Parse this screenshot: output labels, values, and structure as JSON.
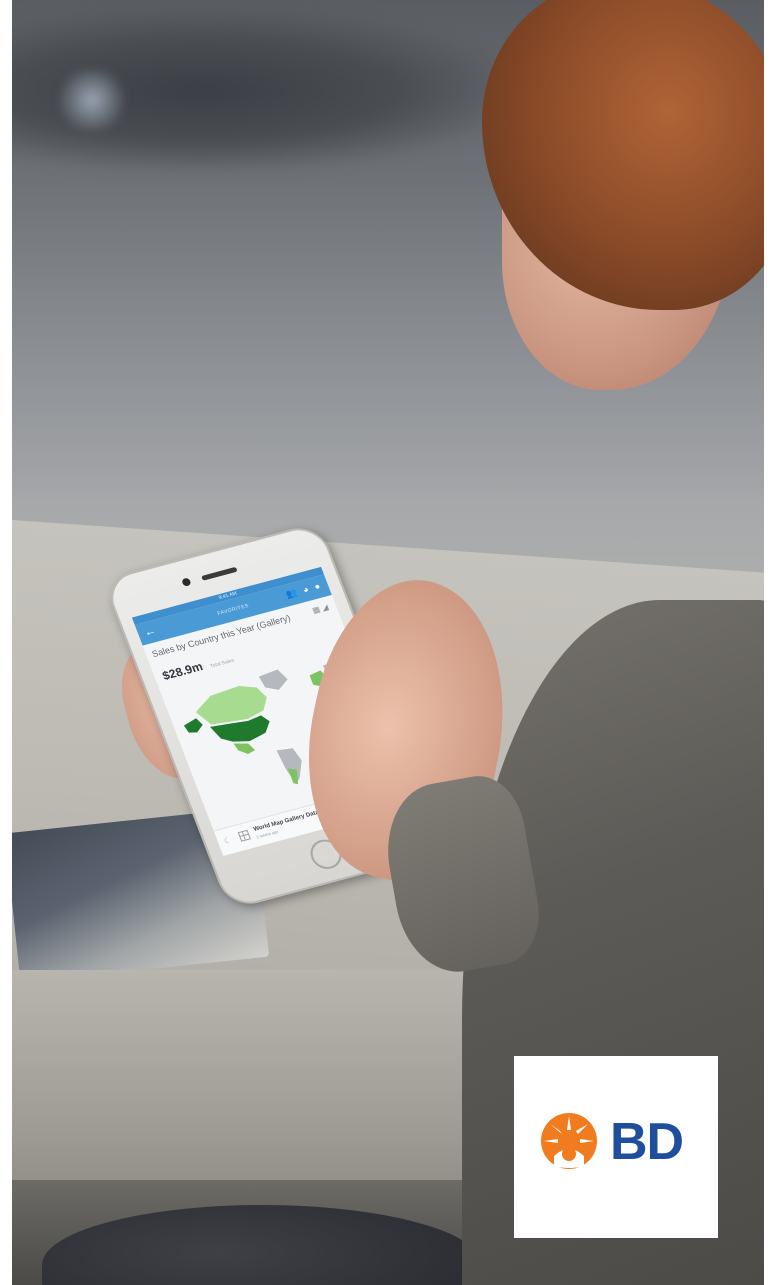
{
  "phone_screen": {
    "status_time": "9:41 AM",
    "app_bar_title": "FAVORITES",
    "card_title": "Sales by Country this Year (Gallery)",
    "metric_value": "$28.9m",
    "metric_label": "Total Sales",
    "footer_title": "World Map Gallery Data",
    "footer_subtitle": "2 weeks ago",
    "footer_more": "•••",
    "back_symbol": "←",
    "app_icons": "👥 ◕ ●"
  },
  "map_colors": {
    "high": "#1f7a2e",
    "mid": "#7cc462",
    "low": "#a7db8f",
    "none": "#b5b9bd"
  },
  "logo": {
    "text": "BD",
    "text_color": "#1f4f9c",
    "mark_color": "#f07c1f"
  }
}
